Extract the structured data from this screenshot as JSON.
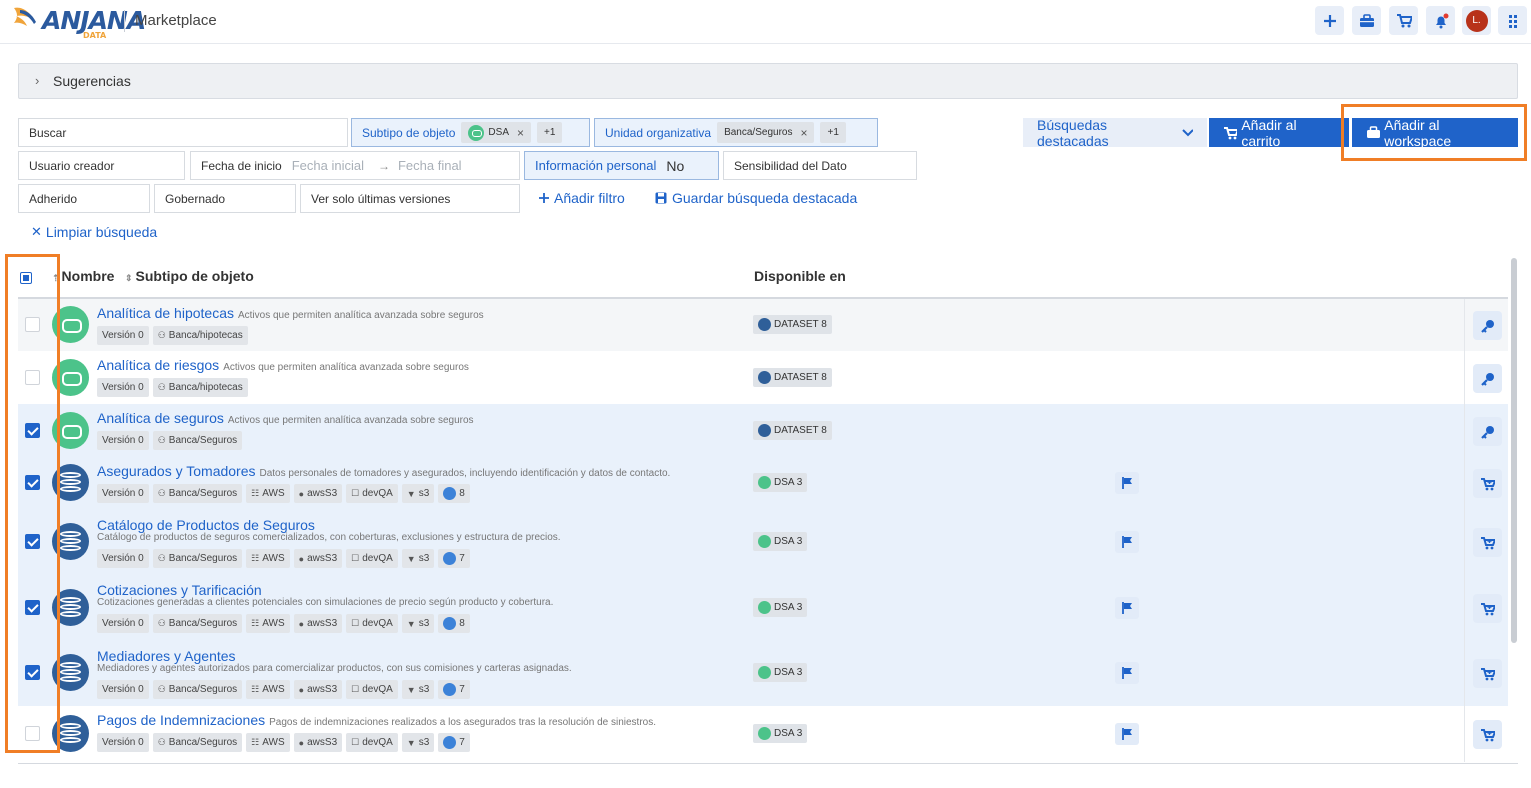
{
  "header": {
    "logo_text": "ANJANA",
    "logo_sub": "DATA",
    "app_title": "Marketplace",
    "avatar_initial": "L.",
    "icons": [
      "plus-icon",
      "briefcase-icon",
      "cart-icon",
      "bell-icon",
      "avatar",
      "grid-menu-icon"
    ]
  },
  "suggestions": {
    "label": "Sugerencias"
  },
  "filters": {
    "search_placeholder": "Buscar",
    "subtype_label": "Subtipo de objeto",
    "subtype_chip": "DSA",
    "subtype_more": "+1",
    "org_label": "Unidad organizativa",
    "org_chip": "Banca/Seguros",
    "org_more": "+1",
    "creator_label": "Usuario creador",
    "date_label": "Fecha de inicio",
    "date_start_placeholder": "Fecha inicial",
    "date_arrow": "→",
    "date_end_placeholder": "Fecha final",
    "personal_label": "Información personal",
    "personal_value": "No",
    "sensitivity_label": "Sensibilidad del Dato",
    "adhered_label": "Adherido",
    "governed_label": "Gobernado",
    "versions_label": "Ver solo últimas versiones",
    "add_filter": "Añadir filtro",
    "save_search": "Guardar búsqueda destacada",
    "clear_search": "Limpiar búsqueda"
  },
  "actions": {
    "featured": "Búsquedas destacadas",
    "add_cart": "Añadir al carrito",
    "add_workspace": "Añadir al workspace"
  },
  "table": {
    "col_name": "Nombre",
    "col_subtype": "Subtipo de objeto",
    "col_available": "Disponible en",
    "rows": [
      {
        "name": "Analítica de hipotecas",
        "desc": "Activos que permiten analítica avanzada sobre seguros",
        "version": "Versión 0",
        "org": "Banca/hipotecas",
        "available": "DATASET 8",
        "checked": false,
        "selected": false,
        "kind": "dsa"
      },
      {
        "name": "Analítica de riesgos",
        "desc": "Activos que permiten analítica avanzada sobre seguros",
        "version": "Versión 0",
        "org": "Banca/hipotecas",
        "available": "DATASET 8",
        "checked": false,
        "selected": false,
        "kind": "dsa"
      },
      {
        "name": "Analítica de seguros",
        "desc": "Activos que permiten analítica avanzada sobre seguros",
        "version": "Versión 0",
        "org": "Banca/Seguros",
        "available": "DATASET 8",
        "checked": true,
        "selected": true,
        "kind": "dsa"
      },
      {
        "name": "Asegurados y Tomadores",
        "desc": "Datos personales de tomadores y asegurados, incluyendo identificación y datos de contacto.",
        "version": "Versión 0",
        "org": "Banca/Seguros",
        "cloud": "AWS",
        "bucket": "awsS3",
        "env": "devQA",
        "loc": "s3",
        "count": "8",
        "available": "DSA 3",
        "checked": true,
        "selected": true,
        "kind": "dataset"
      },
      {
        "name": "Catálogo de Productos de Seguros",
        "desc": "Catálogo de productos de seguros comercializados, con coberturas, exclusiones y estructura de precios.",
        "version": "Versión 0",
        "org": "Banca/Seguros",
        "cloud": "AWS",
        "bucket": "awsS3",
        "env": "devQA",
        "loc": "s3",
        "count": "7",
        "available": "DSA 3",
        "checked": true,
        "selected": true,
        "kind": "dataset"
      },
      {
        "name": "Cotizaciones y Tarificación",
        "desc": "Cotizaciones generadas a clientes potenciales con simulaciones de precio según producto y cobertura.",
        "version": "Versión 0",
        "org": "Banca/Seguros",
        "cloud": "AWS",
        "bucket": "awsS3",
        "env": "devQA",
        "loc": "s3",
        "count": "8",
        "available": "DSA 3",
        "checked": true,
        "selected": true,
        "kind": "dataset"
      },
      {
        "name": "Mediadores y Agentes",
        "desc": "Mediadores y agentes autorizados para comercializar productos, con sus comisiones y carteras asignadas.",
        "version": "Versión 0",
        "org": "Banca/Seguros",
        "cloud": "AWS",
        "bucket": "awsS3",
        "env": "devQA",
        "loc": "s3",
        "count": "7",
        "available": "DSA 3",
        "checked": true,
        "selected": true,
        "kind": "dataset"
      },
      {
        "name": "Pagos de Indemnizaciones",
        "desc": "Pagos de indemnizaciones realizados a los asegurados tras la resolución de siniestros.",
        "version": "Versión 0",
        "org": "Banca/Seguros",
        "cloud": "AWS",
        "bucket": "awsS3",
        "env": "devQA",
        "loc": "s3",
        "count": "7",
        "available": "DSA 3",
        "checked": false,
        "selected": false,
        "kind": "dataset"
      }
    ]
  },
  "colors": {
    "accent": "#1f63c9",
    "highlight": "#f07e26",
    "selected_row": "#e9f1fb",
    "dsa_green": "#4cc38a",
    "dataset_blue": "#2f5f99"
  }
}
